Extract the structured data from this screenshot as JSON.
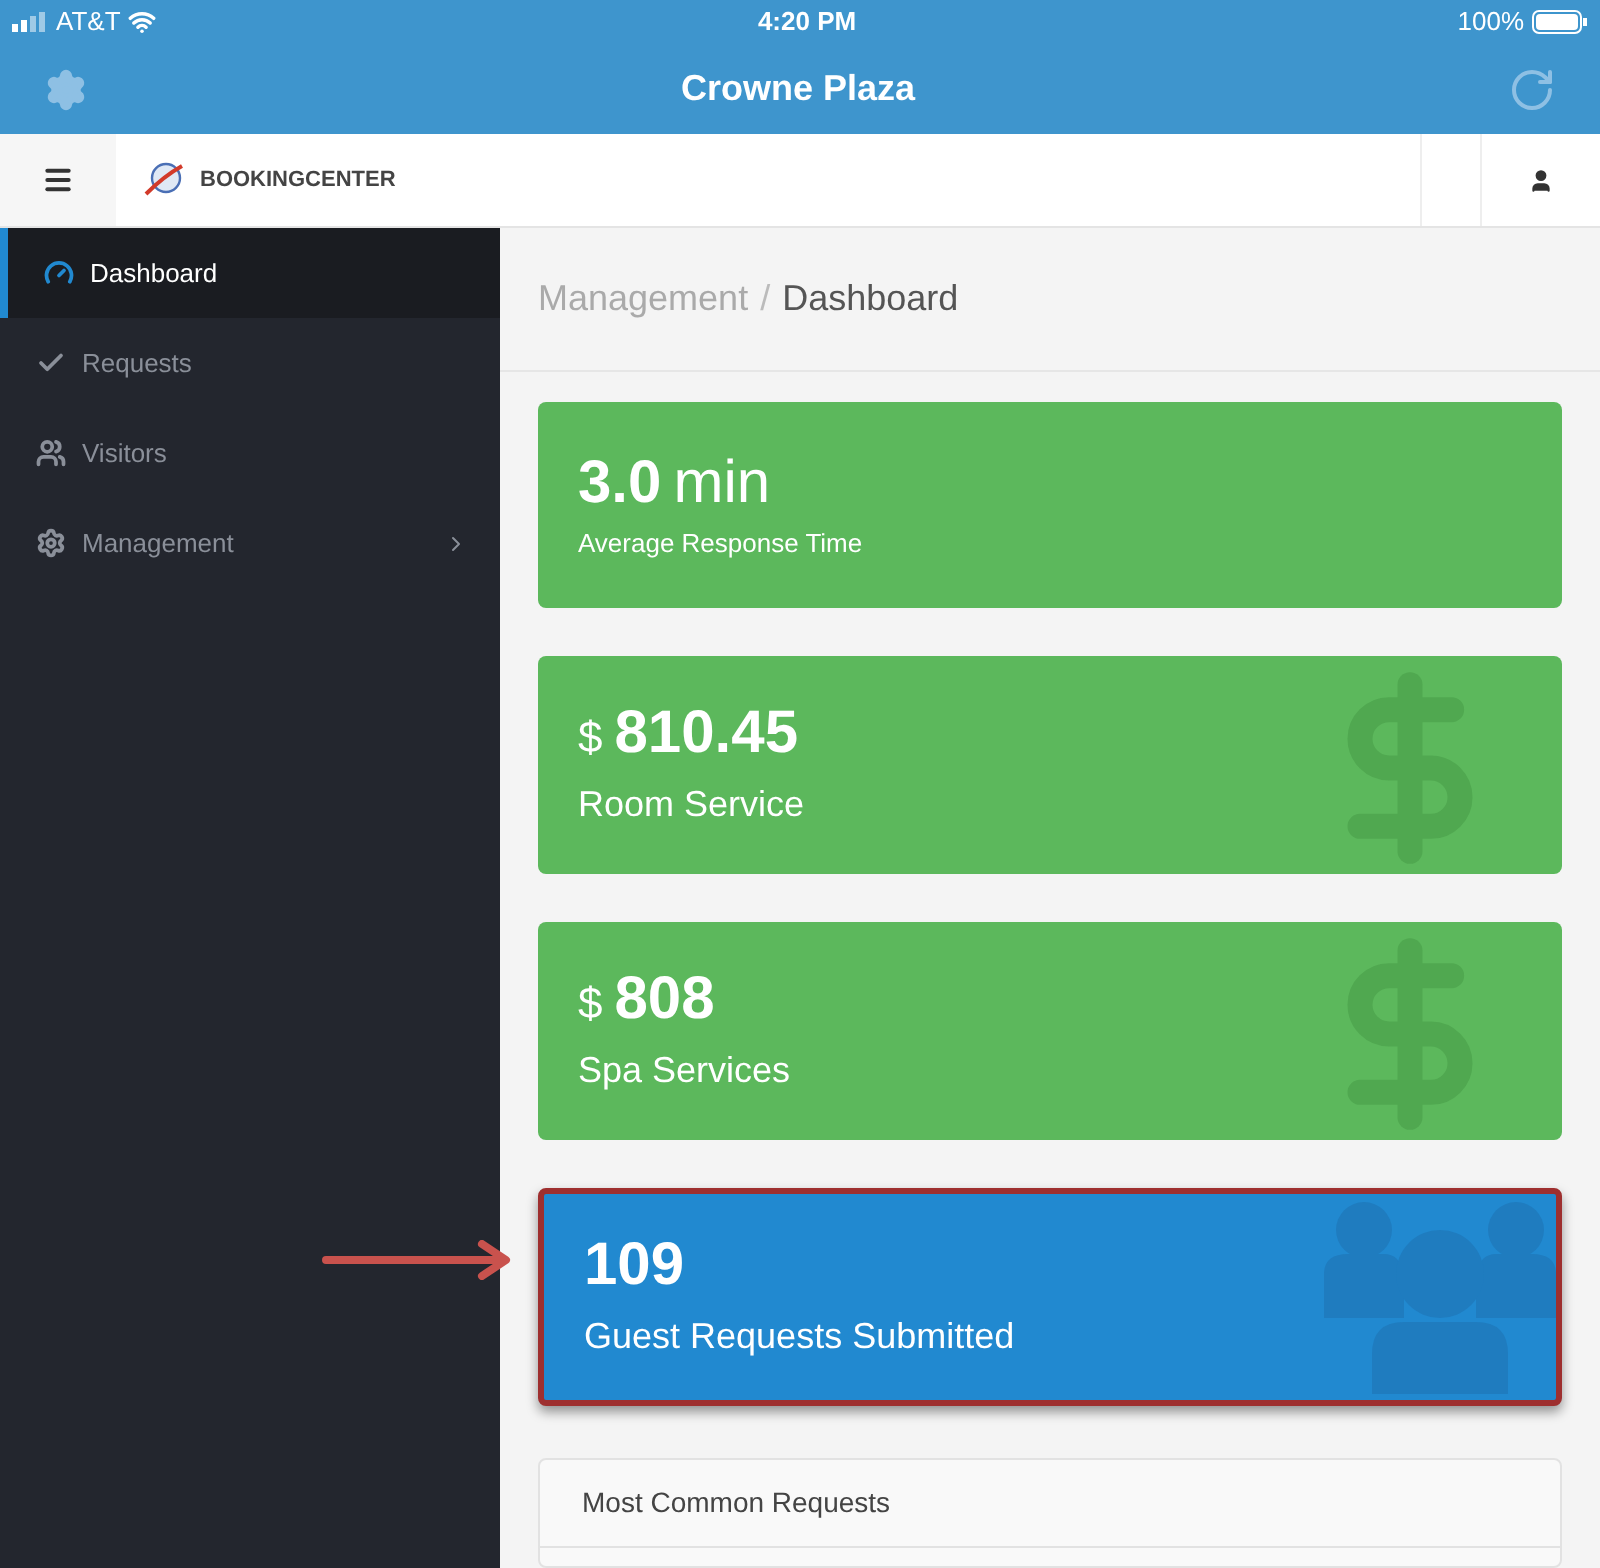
{
  "status_bar": {
    "carrier": "AT&T",
    "time": "4:20 PM",
    "battery": "100%"
  },
  "window": {
    "title": "Crowne Plaza"
  },
  "header": {
    "brand": "BOOKINGCENTER"
  },
  "sidebar": {
    "items": [
      {
        "label": "Dashboard",
        "selected": true,
        "submenu": false
      },
      {
        "label": "Requests",
        "selected": false,
        "submenu": false
      },
      {
        "label": "Visitors",
        "selected": false,
        "submenu": false
      },
      {
        "label": "Management",
        "selected": false,
        "submenu": true
      }
    ]
  },
  "breadcrumb": [
    {
      "label": "Management",
      "current": false
    },
    {
      "label": "Dashboard",
      "current": true
    }
  ],
  "breadcrumb_separator": "/",
  "cards": [
    {
      "kind": "time",
      "value": "3.0",
      "unit": "min",
      "label": "Average Response Time",
      "highlighted": false
    },
    {
      "kind": "money",
      "prefix": "$",
      "value": "810.45",
      "label": "Room Service",
      "highlighted": false
    },
    {
      "kind": "money",
      "prefix": "$",
      "value": "808",
      "label": "Spa Services",
      "highlighted": false
    },
    {
      "kind": "count",
      "value": "109",
      "label": "Guest Requests Submitted",
      "highlighted": true
    }
  ],
  "panel": {
    "title": "Most Common Requests"
  }
}
